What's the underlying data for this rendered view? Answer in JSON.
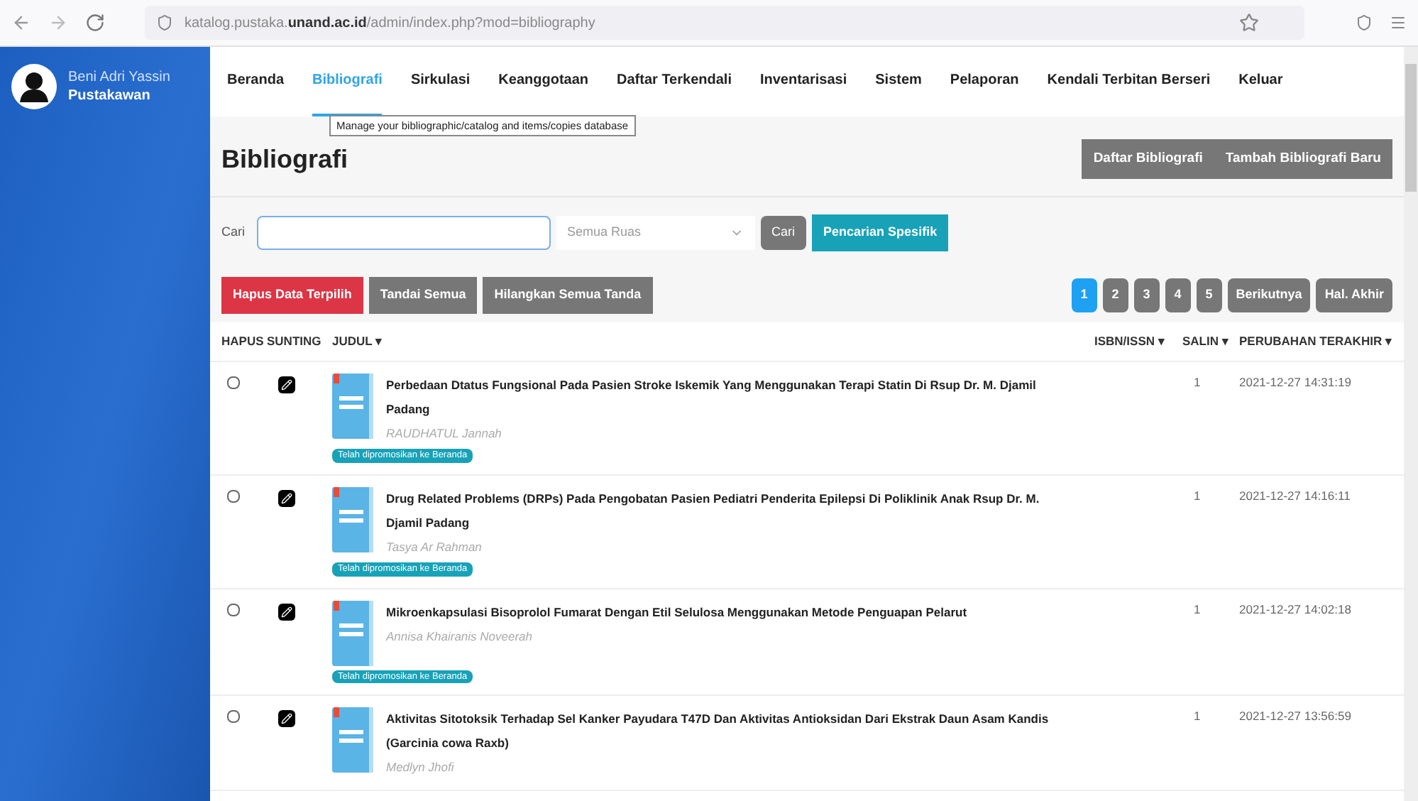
{
  "browser": {
    "url_host_prefix": "katalog.pustaka.",
    "url_host": "unand.ac.id",
    "url_path": "/admin/index.php?mod=bibliography"
  },
  "user": {
    "name": "Beni Adri Yassin",
    "role": "Pustakawan"
  },
  "nav": [
    {
      "label": "Beranda",
      "selected": false
    },
    {
      "label": "Bibliografi",
      "selected": true
    },
    {
      "label": "Sirkulasi",
      "selected": false
    },
    {
      "label": "Keanggotaan",
      "selected": false
    },
    {
      "label": "Daftar Terkendali",
      "selected": false
    },
    {
      "label": "Inventarisasi",
      "selected": false
    },
    {
      "label": "Sistem",
      "selected": false
    },
    {
      "label": "Pelaporan",
      "selected": false
    },
    {
      "label": "Kendali Terbitan Berseri",
      "selected": false
    },
    {
      "label": "Keluar",
      "selected": false
    }
  ],
  "tooltip": "Manage your bibliographic/catalog and items/copies database",
  "page_title": "Bibliografi",
  "header_buttons": [
    "Daftar Bibliografi",
    "Tambah Bibliografi Baru"
  ],
  "search": {
    "label": "Cari",
    "field_select": "Semua Ruas",
    "button": "Cari",
    "advanced_button": "Pencarian Spesifik"
  },
  "actions": [
    {
      "label": "Hapus Data Terpilih",
      "kind": "danger"
    },
    {
      "label": "Tandai Semua",
      "kind": "default"
    },
    {
      "label": "Hilangkan Semua Tanda",
      "kind": "default"
    }
  ],
  "pagination": [
    {
      "label": "1",
      "selected": true
    },
    {
      "label": "2",
      "selected": false
    },
    {
      "label": "3",
      "selected": false
    },
    {
      "label": "4",
      "selected": false
    },
    {
      "label": "5",
      "selected": false
    },
    {
      "label": "Berikutnya",
      "selected": false
    },
    {
      "label": "Hal. Akhir",
      "selected": false
    }
  ],
  "table": {
    "columns": [
      "HAPUS",
      "SUNTING",
      "JUDUL ▾",
      "ISBN/ISSN ▾",
      "SALIN ▾",
      "PERUBAHAN TERAKHIR ▾"
    ],
    "rows": [
      {
        "checked": false,
        "title": "Perbedaan Dtatus Fungsional Pada Pasien Stroke Iskemik Yang Menggunakan Terapi Statin Di Rsup Dr. M. Djamil Padang",
        "author": "RAUDHATUL Jannah",
        "badge": "Telah dipromosikan ke Beranda",
        "isbn": "",
        "copies": "1",
        "modified": "2021-12-27 14:31:19"
      },
      {
        "checked": false,
        "title": "Drug Related Problems (DRPs) Pada Pengobatan Pasien Pediatri Penderita Epilepsi Di Poliklinik Anak Rsup Dr. M. Djamil Padang",
        "author": "Tasya Ar Rahman",
        "badge": "Telah dipromosikan ke Beranda",
        "isbn": "",
        "copies": "1",
        "modified": "2021-12-27 14:16:11"
      },
      {
        "checked": false,
        "title": "Mikroenkapsulasi Bisoprolol Fumarat Dengan Etil Selulosa Menggunakan Metode Penguapan Pelarut",
        "author": "Annisa Khairanis Noveerah",
        "badge": "Telah dipromosikan ke Beranda",
        "isbn": "",
        "copies": "1",
        "modified": "2021-12-27 14:02:18"
      },
      {
        "checked": false,
        "title": "Aktivitas Sitotoksik Terhadap Sel Kanker Payudara T47D Dan Aktivitas Antioksidan Dari Ekstrak Daun Asam Kandis (Garcinia cowa Raxb)",
        "author": "Medlyn Jhofi",
        "isbn": "",
        "copies": "1",
        "modified": "2021-12-27 13:56:59"
      }
    ]
  }
}
